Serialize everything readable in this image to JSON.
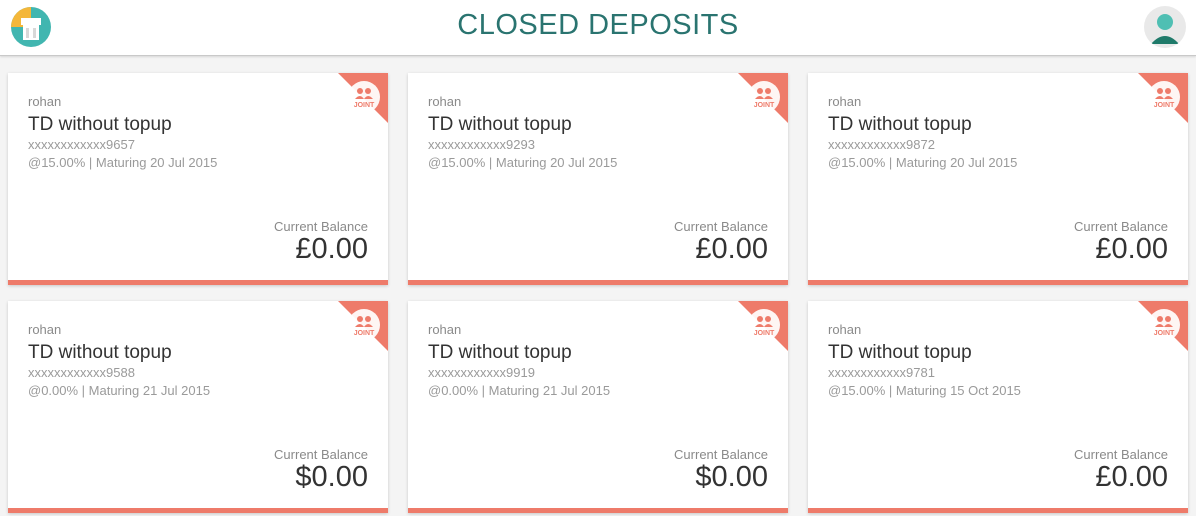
{
  "header": {
    "title": "CLOSED DEPOSITS",
    "logo_icon": "bank-logo-icon",
    "avatar_icon": "user-avatar-icon"
  },
  "colors": {
    "accent": "#ee7b6a",
    "title": "#2a7470",
    "avatar": "#1f7a6a"
  },
  "cards": [
    {
      "owner": "rohan",
      "name": "TD without topup",
      "account": "xxxxxxxxxxxx9657",
      "rate": "@15.00% | Maturing 20 Jul 2015",
      "balance_label": "Current Balance",
      "balance": "£0.00",
      "badge": "JOINT"
    },
    {
      "owner": "rohan",
      "name": "TD without topup",
      "account": "xxxxxxxxxxxx9293",
      "rate": "@15.00% | Maturing 20 Jul 2015",
      "balance_label": "Current Balance",
      "balance": "£0.00",
      "badge": "JOINT"
    },
    {
      "owner": "rohan",
      "name": "TD without topup",
      "account": "xxxxxxxxxxxx9872",
      "rate": "@15.00% | Maturing 20 Jul 2015",
      "balance_label": "Current Balance",
      "balance": "£0.00",
      "badge": "JOINT"
    },
    {
      "owner": "rohan",
      "name": "TD without topup",
      "account": "xxxxxxxxxxxx9588",
      "rate": "@0.00% | Maturing 21 Jul 2015",
      "balance_label": "Current Balance",
      "balance": "$0.00",
      "badge": "JOINT"
    },
    {
      "owner": "rohan",
      "name": "TD without topup",
      "account": "xxxxxxxxxxxx9919",
      "rate": "@0.00% | Maturing 21 Jul 2015",
      "balance_label": "Current Balance",
      "balance": "$0.00",
      "badge": "JOINT"
    },
    {
      "owner": "rohan",
      "name": "TD without topup",
      "account": "xxxxxxxxxxxx9781",
      "rate": "@15.00% | Maturing 15 Oct 2015",
      "balance_label": "Current Balance",
      "balance": "£0.00",
      "badge": "JOINT"
    }
  ]
}
